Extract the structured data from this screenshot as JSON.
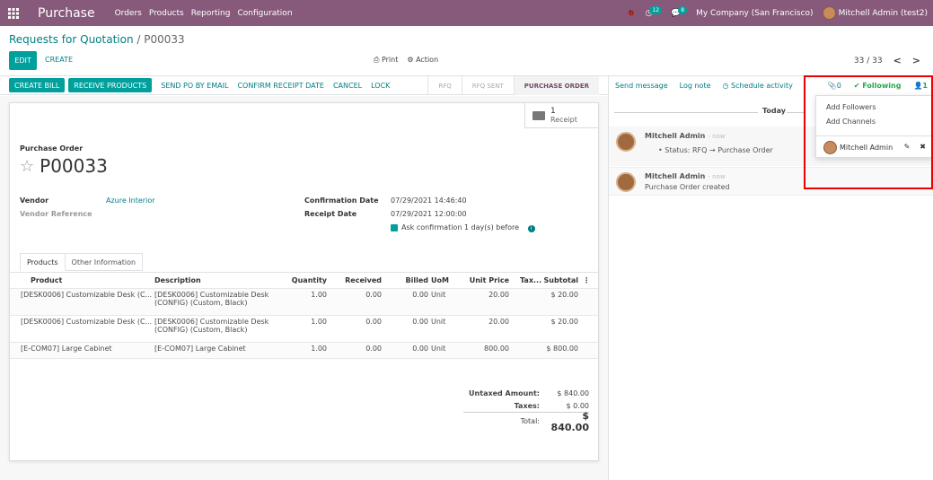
{
  "topbar": {
    "app_name": "Purchase",
    "menu": [
      "Orders",
      "Products",
      "Reporting",
      "Configuration"
    ],
    "activity_badge": "12",
    "messages_badge": "8",
    "company": "My Company (San Francisco)",
    "user": "Mitchell Admin (test2)",
    "bg_color": "#875a7b"
  },
  "breadcrumb": {
    "parent": "Requests for Quotation",
    "sep": "/",
    "current": "P00033"
  },
  "control": {
    "edit": "EDIT",
    "create": "CREATE",
    "print": "Print",
    "action": "Action",
    "pager": "33 / 33",
    "prev": "<",
    "next": ">"
  },
  "statusbar": {
    "buttons": [
      "CREATE BILL",
      "RECEIVE PRODUCTS",
      "SEND PO BY EMAIL",
      "CONFIRM RECEIPT DATE",
      "CANCEL",
      "LOCK"
    ],
    "stages": [
      "RFQ",
      "RFQ SENT",
      "PURCHASE ORDER"
    ],
    "active_stage": "PURCHASE ORDER"
  },
  "smart_button": {
    "count": "1",
    "label": "Receipt"
  },
  "form": {
    "title_label": "Purchase Order",
    "name": "P00033",
    "vendor_label": "Vendor",
    "vendor": "Azure Interior",
    "vendor_ref_label": "Vendor Reference",
    "confirmation_date_label": "Confirmation Date",
    "confirmation_date": "07/29/2021 14:46:40",
    "receipt_date_label": "Receipt Date",
    "receipt_date": "07/29/2021 12:00:00",
    "ask_confirmation": "Ask confirmation",
    "ask_days": "1",
    "ask_suffix": "day(s) before"
  },
  "tabs": [
    "Products",
    "Other Information"
  ],
  "lines": {
    "headers": [
      "Product",
      "Description",
      "Quantity",
      "Received",
      "Billed",
      "UoM",
      "Unit Price",
      "Tax...",
      "Subtotal"
    ],
    "rows": [
      {
        "product": "[DESK0006] Customizable Desk (C...",
        "description": "[DESK0006] Customizable Desk (CONFIG) (Custom, Black)",
        "qty": "1.00",
        "received": "0.00",
        "billed": "0.00",
        "uom": "Unit",
        "price": "20.00",
        "tax": "",
        "subtotal": "$ 20.00"
      },
      {
        "product": "[DESK0006] Customizable Desk (C...",
        "description": "[DESK0006] Customizable Desk (CONFIG) (Custom, Black)",
        "qty": "1.00",
        "received": "0.00",
        "billed": "0.00",
        "uom": "Unit",
        "price": "20.00",
        "tax": "",
        "subtotal": "$ 20.00"
      },
      {
        "product": "[E-COM07] Large Cabinet",
        "description": "[E-COM07] Large Cabinet",
        "qty": "1.00",
        "received": "0.00",
        "billed": "0.00",
        "uom": "Unit",
        "price": "800.00",
        "tax": "",
        "subtotal": "$ 800.00"
      }
    ]
  },
  "totals": {
    "untaxed_label": "Untaxed Amount:",
    "untaxed": "$ 840.00",
    "taxes_label": "Taxes:",
    "taxes": "$ 0.00",
    "total_label": "Total:",
    "total": "$ 840.00"
  },
  "chatter": {
    "send_message": "Send message",
    "log_note": "Log note",
    "schedule_activity": "Schedule activity",
    "attachments": "0",
    "following": "Following",
    "followers_count": "1",
    "today": "Today",
    "messages": [
      {
        "author": "Mitchell Admin",
        "when": "- now",
        "body": "Status: RFQ → Purchase Order"
      },
      {
        "author": "Mitchell Admin",
        "when": "- now",
        "body": "Purchase Order created"
      }
    ]
  },
  "followers_dropdown": {
    "add_followers": "Add Followers",
    "add_channels": "Add Channels",
    "follower_name": "Mitchell Admin"
  }
}
